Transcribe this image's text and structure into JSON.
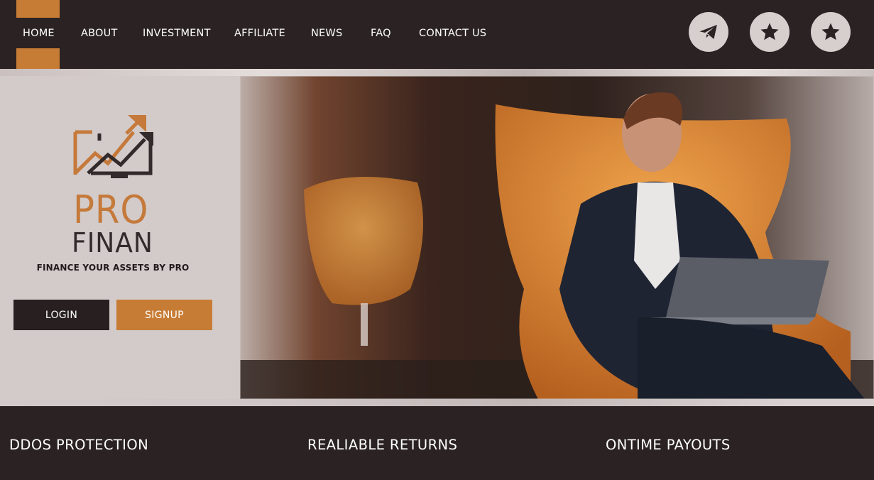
{
  "nav": {
    "items": [
      {
        "label": "HOME",
        "active": true
      },
      {
        "label": "ABOUT",
        "active": false
      },
      {
        "label": "INVESTMENT",
        "active": false
      },
      {
        "label": "AFFILIATE",
        "active": false
      },
      {
        "label": "NEWS",
        "active": false
      },
      {
        "label": "FAQ",
        "active": false
      },
      {
        "label": "CONTACT US",
        "active": false
      }
    ]
  },
  "social": {
    "icons": [
      "telegram-icon",
      "star-icon",
      "star-icon"
    ]
  },
  "brand": {
    "line1": "PRO",
    "line2": "FINAN",
    "tagline": "FINANCE YOUR ASSETS BY PRO"
  },
  "auth": {
    "login_label": "LOGIN",
    "signup_label": "SIGNUP"
  },
  "features": {
    "items": [
      "DDOS PROTECTION",
      "REALIABLE RETURNS",
      "ONTIME PAYOUTS"
    ]
  },
  "colors": {
    "accent": "#c77c35",
    "dark": "#2a2223",
    "panel": "#d2cbca"
  }
}
